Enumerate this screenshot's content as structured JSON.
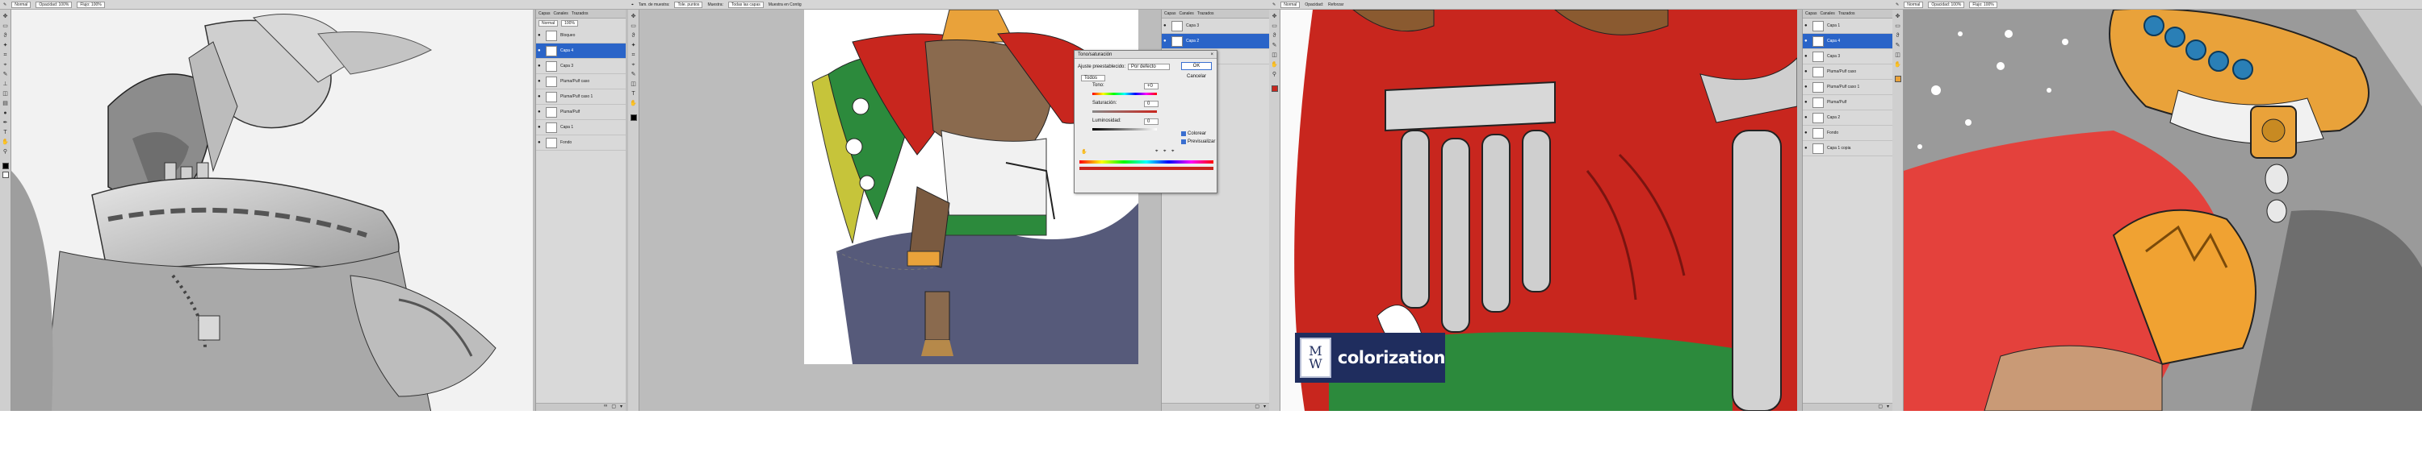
{
  "panel1": {
    "options": [
      "Normal",
      "Opacidad: 100%",
      "Flujo: 100%"
    ],
    "layers": [
      {
        "label": "Bloqueo",
        "selected": false
      },
      {
        "label": "Capa 4",
        "selected": true
      },
      {
        "label": "Capa 3",
        "selected": false
      },
      {
        "label": "Pluma/Pulf caso",
        "selected": false
      },
      {
        "label": "Pluma/Pulf caso 1",
        "selected": false
      },
      {
        "label": "Pluma/Pulf",
        "selected": false
      },
      {
        "label": "Capa 1",
        "selected": false
      },
      {
        "label": "Fondo",
        "selected": false
      }
    ],
    "layer_tabs": [
      "Capas",
      "Canales",
      "Trazados"
    ],
    "blend": "Normal",
    "opacity": "100%"
  },
  "panel2": {
    "options": [
      "Tam. de muestra:",
      "Tole. puntos",
      "Muestra:",
      "Todas las capas",
      "Muestra en Contig"
    ],
    "layers": [
      {
        "label": "Capa 3",
        "selected": false
      },
      {
        "label": "Capa 2",
        "selected": true
      },
      {
        "label": "Capa 1",
        "selected": false
      }
    ],
    "dialog": {
      "title": "Tono/saturación",
      "preset_label": "Ajuste preestablecido:",
      "preset_value": "Por defecto",
      "ok_label": "OK",
      "cancel_label": "Cancelar",
      "channel": "Todos",
      "hue_label": "Tono:",
      "hue_value": "+0",
      "sat_label": "Saturación:",
      "sat_value": "0",
      "light_label": "Luminosidad:",
      "light_value": "0",
      "colorize_label": "Colorear",
      "preview_label": "Previsualizar"
    }
  },
  "panel3": {
    "options": [
      "Normal",
      "Opacidad:",
      "Reforzar"
    ],
    "layers": [
      {
        "label": "Capa 1",
        "selected": false
      },
      {
        "label": "Capa 4",
        "selected": true
      },
      {
        "label": "Capa 3",
        "selected": false
      },
      {
        "label": "Pluma/Pulf caso",
        "selected": false
      },
      {
        "label": "Pluma/Pulf caso 1",
        "selected": false
      },
      {
        "label": "Pluma/Pulf",
        "selected": false
      },
      {
        "label": "Capa 2",
        "selected": false
      },
      {
        "label": "Fondo",
        "selected": false
      },
      {
        "label": "Capa 1 copia",
        "selected": false
      }
    ],
    "watermark": {
      "logo_top": "M",
      "logo_bottom": "W",
      "text": "colorization"
    }
  },
  "panel4": {
    "options": [
      "Normal",
      "Opacidad: 100%",
      "Flujo: 100%"
    ]
  },
  "colors": {
    "ui_gray": "#bdbdbd",
    "layer_selected": "#2a64c8",
    "cape_red": "#c8261e",
    "cape_green": "#2c8a3c",
    "watermark_navy": "#1f2d5e",
    "gold": "#e9a23a",
    "turquoise": "#2a7fb6"
  }
}
